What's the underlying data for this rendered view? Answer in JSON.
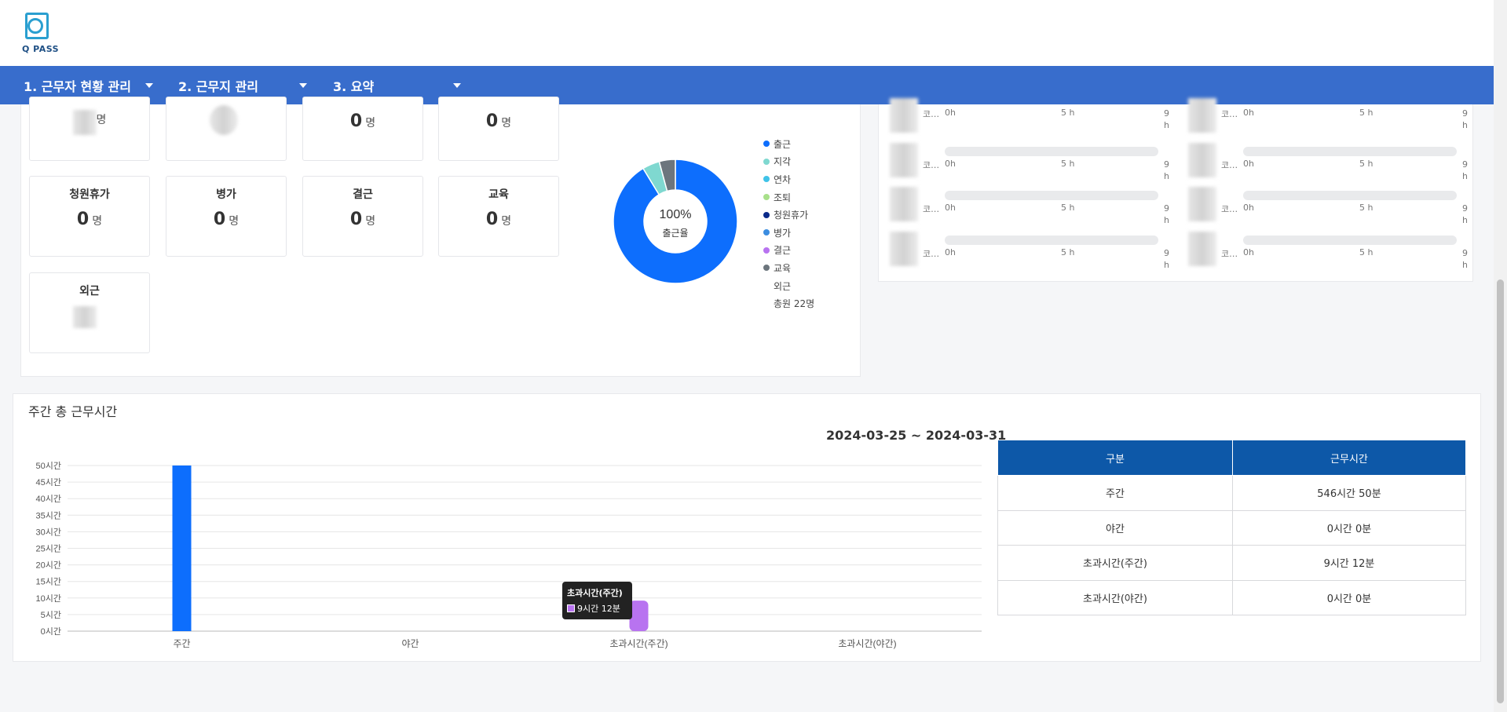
{
  "logo": {
    "text": "Q PASS"
  },
  "nav": [
    {
      "label": "1. 근무자 현황 관리"
    },
    {
      "label": "2. 근무지 관리"
    },
    {
      "label": "3. 요약"
    }
  ],
  "stat_cards": {
    "unit": "명",
    "top_values": [
      "0",
      "0"
    ],
    "cards": [
      {
        "label": "청원휴가",
        "value": "0"
      },
      {
        "label": "병가",
        "value": "0"
      },
      {
        "label": "결근",
        "value": "0"
      },
      {
        "label": "교육",
        "value": "0"
      },
      {
        "label": "외근",
        "value": ""
      }
    ]
  },
  "attendance_donut": {
    "center_percent": "100%",
    "center_label": "출근율",
    "legend": [
      {
        "label": "출근",
        "color": "#0d6efd"
      },
      {
        "label": "지각",
        "color": "#7fd8d0"
      },
      {
        "label": "연차",
        "color": "#3fc3e8"
      },
      {
        "label": "조퇴",
        "color": "#a8e08a"
      },
      {
        "label": "청원휴가",
        "color": "#0a2a8a"
      },
      {
        "label": "병가",
        "color": "#3b8de0"
      },
      {
        "label": "결근",
        "color": "#b873f0"
      },
      {
        "label": "교육",
        "color": "#6c757d"
      },
      {
        "label": "외근",
        "color": ""
      }
    ],
    "total": "총원 22명",
    "slices": [
      {
        "label": "출근",
        "share": 0.913
      },
      {
        "label": "지각",
        "share": 0.045
      },
      {
        "label": "교육",
        "share": 0.042
      }
    ]
  },
  "worker_rows": {
    "ticks": [
      "0h",
      "5 h",
      "9 h"
    ],
    "truncated": "코…"
  },
  "weekly_chart": {
    "title": "주간 총 근무시간",
    "date_range": "2024-03-25 ~ 2024-03-31",
    "tooltip": {
      "title": "초과시간(주간)",
      "value": "9시간 12분"
    }
  },
  "summary_table": {
    "headers": [
      "구분",
      "근무시간"
    ],
    "rows": [
      [
        "주간",
        "546시간 50분"
      ],
      [
        "야간",
        "0시간 0분"
      ],
      [
        "초과시간(주간)",
        "9시간 12분"
      ],
      [
        "초과시간(야간)",
        "0시간 0분"
      ]
    ]
  },
  "chart_data": {
    "type": "bar",
    "title": "",
    "xlabel": "",
    "ylabel": "",
    "categories": [
      "주간",
      "야간",
      "초과시간(주간)",
      "초과시간(야간)"
    ],
    "values": [
      546.83,
      0,
      9.2,
      0
    ],
    "colors": [
      "#0d6efd",
      "#0d6efd",
      "#b873f0",
      "#0d6efd"
    ],
    "ylim": [
      0,
      50
    ],
    "yticks": [
      0,
      5,
      10,
      15,
      20,
      25,
      30,
      35,
      40,
      45,
      50
    ],
    "ytick_labels": [
      "0시간",
      "5시간",
      "10시간",
      "15시간",
      "20시간",
      "25시간",
      "30시간",
      "35시간",
      "40시간",
      "45시간",
      "50시간"
    ],
    "grid": true
  }
}
